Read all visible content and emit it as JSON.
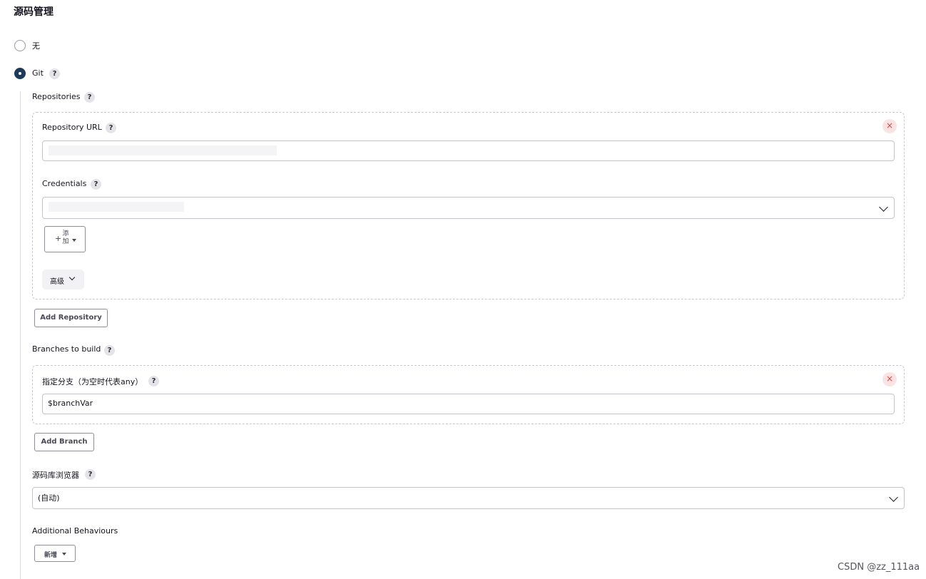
{
  "section_title": "源码管理",
  "scm_options": [
    {
      "label": "无",
      "selected": false
    },
    {
      "label": "Git",
      "selected": true
    }
  ],
  "help_glyph": "?",
  "repositories": {
    "label": "Repositories",
    "repo_url_label": "Repository URL",
    "repo_url_value": "",
    "credentials_label": "Credentials",
    "credentials_value": "",
    "add_button_label": "添加",
    "advanced_label": "高级",
    "add_repository_label": "Add Repository"
  },
  "branches": {
    "label": "Branches to build",
    "branch_specifier_label": "指定分支（为空时代表any）",
    "branch_specifier_value": "$branchVar",
    "add_branch_label": "Add Branch"
  },
  "repo_browser": {
    "label": "源码库浏览器",
    "value": "(自动)"
  },
  "additional_behaviours": {
    "label": "Additional Behaviours",
    "add_label": "新增"
  },
  "close_glyph": "×",
  "watermark": "CSDN @zz_111aa",
  "colors": {
    "radio_selected": "#1b3a5c",
    "close_icon": "#d2453e"
  }
}
